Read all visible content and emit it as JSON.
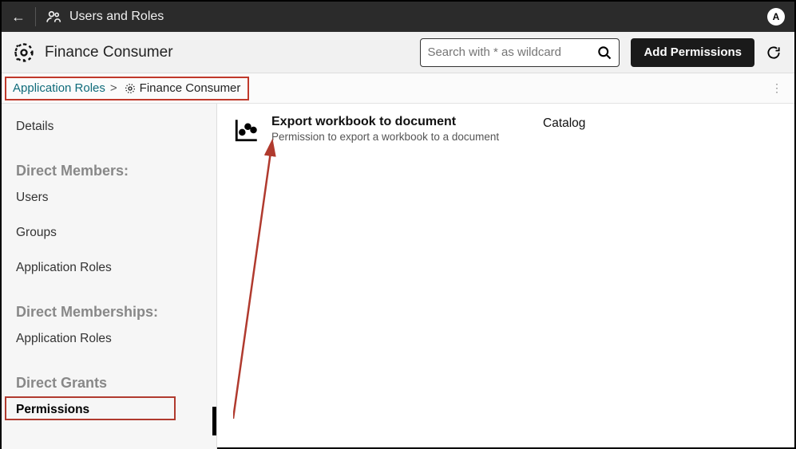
{
  "header": {
    "title": "Users and Roles",
    "avatar_letter": "A"
  },
  "toolbar": {
    "role_title": "Finance Consumer",
    "search_placeholder": "Search with * as wildcard",
    "add_button": "Add Permissions"
  },
  "breadcrumb": {
    "root": "Application Roles",
    "current": "Finance Consumer"
  },
  "sidebar": {
    "details": "Details",
    "h1": "Direct Members:",
    "users": "Users",
    "groups": "Groups",
    "app_roles_1": "Application Roles",
    "h2": "Direct Memberships:",
    "app_roles_2": "Application Roles",
    "h3": "Direct Grants",
    "permissions": "Permissions"
  },
  "permission": {
    "title": "Export workbook to document",
    "description": "Permission to export a workbook to a document",
    "category": "Catalog"
  }
}
